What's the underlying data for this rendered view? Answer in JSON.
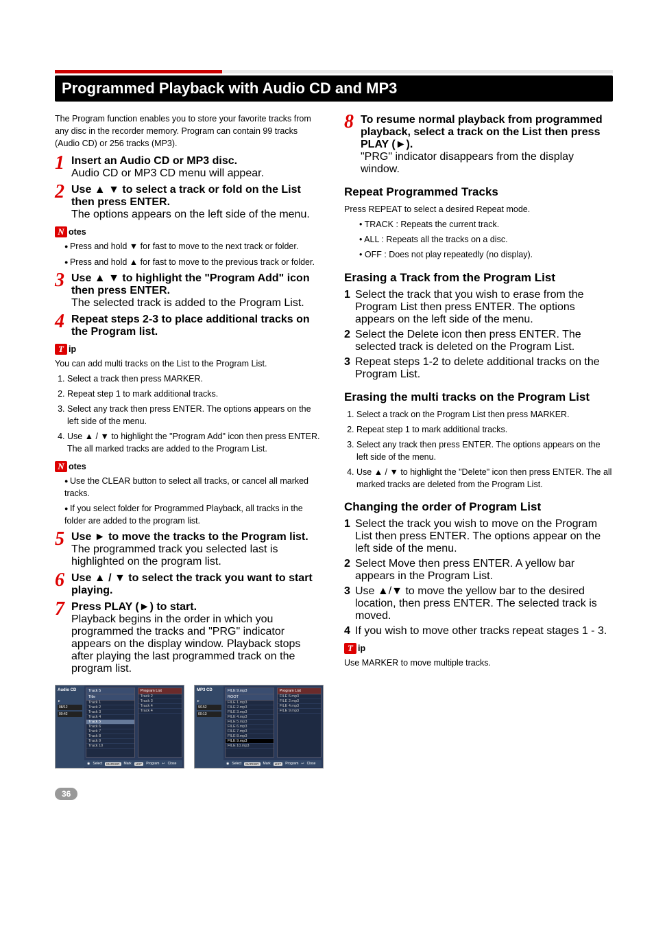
{
  "title": "Programmed Playback with Audio CD and MP3",
  "intro": "The Program function enables you to store your favorite tracks from any disc in the recorder memory. Program can contain 99 tracks (Audio CD) or 256 tracks (MP3).",
  "steps_left": [
    {
      "num": "1",
      "bold": "Insert an Audio CD or MP3 disc.",
      "sub": "Audio CD or MP3 CD menu will appear."
    },
    {
      "num": "2",
      "bold": "Use ▲ ▼ to select a track or fold on the List then press ENTER.",
      "sub": "The options appears on the left side of the menu."
    }
  ],
  "notes1_label": "otes",
  "notes1_items": [
    "Press and hold ▼ for fast to move to the next track or folder.",
    "Press and hold ▲ for fast to move to the previous track or folder."
  ],
  "steps_left2": [
    {
      "num": "3",
      "bold": "Use ▲ ▼ to highlight the \"Program Add\" icon then press ENTER.",
      "sub": "The selected track is added to the Program List."
    },
    {
      "num": "4",
      "bold": "Repeat steps 2-3 to place additional tracks on the Program list.",
      "sub": ""
    }
  ],
  "tip1_label": "ip",
  "tip1_lead": "You can add multi tracks on the List to the Program List.",
  "tip1_list": [
    "Select a track then press MARKER.",
    "Repeat step 1 to mark additional tracks.",
    "Select any track then press ENTER.\nThe options appears on the left side of the menu.",
    "Use ▲ / ▼ to highlight the \"Program Add\" icon then press ENTER.\nThe all marked tracks are added to the Program List."
  ],
  "notes2_label": "otes",
  "notes2_items": [
    "Use the CLEAR button to select all tracks, or cancel all marked tracks.",
    "If you select folder for Programmed Playback, all tracks in the folder are added to the program list."
  ],
  "steps_left3": [
    {
      "num": "5",
      "bold": "Use ► to move the tracks to the Program list.",
      "sub": "The programmed track you selected last is highlighted on the program list."
    },
    {
      "num": "6",
      "bold": "Use ▲ / ▼ to select the track you want to start playing.",
      "sub": ""
    },
    {
      "num": "7",
      "bold": "Press PLAY (►) to start.",
      "sub": "Playback begins in the order in which you programmed the tracks and \"PRG\" indicator appears on the display window.\nPlayback stops after playing the last programmed track on the program list."
    }
  ],
  "step8": {
    "num": "8",
    "bold": "To resume normal playback from programmed playback, select a track on the List then press PLAY (►).",
    "sub": "\"PRG\" indicator disappears from the display window."
  },
  "h_repeat": "Repeat Programmed Tracks",
  "repeat_lead": "Press REPEAT to select a desired Repeat mode.",
  "repeat_items": [
    "TRACK : Repeats the current track.",
    "ALL : Repeats all the tracks on a disc.",
    "OFF : Does not play repeatedly (no display)."
  ],
  "h_erase": "Erasing a Track from the Program List",
  "erase_steps": [
    "Select the track that you wish to erase from the Program List then press ENTER.\nThe options appears on the left side of the menu.",
    "Select the Delete icon then press ENTER.\nThe selected track is deleted on the Program List.",
    "Repeat steps 1-2 to delete additional tracks on the Program List."
  ],
  "h_erasemulti": "Erasing the multi tracks on the Program List",
  "erasemulti_steps": [
    "Select a track on the Program List then press MARKER.",
    "Repeat step 1 to mark additional tracks.",
    "Select any track then press ENTER.\nThe options appears on the left side of the menu.",
    "Use ▲ / ▼ to highlight the \"Delete\" icon then press ENTER.\nThe all marked tracks are deleted from the Program List."
  ],
  "h_change": "Changing the order of Program List",
  "change_steps": [
    "Select the track you wish to move on the Program List then press ENTER.\nThe options appear on the left side of the menu.",
    "Select Move then press ENTER.\nA yellow bar appears in the Program List.",
    "Use ▲/▼ to move the yellow bar to the desired location, then press ENTER.\nThe selected track is moved.",
    "If you wish to move other tracks repeat stages 1 - 3."
  ],
  "tip2_label": "ip",
  "tip2_text": "Use MARKER to move multiple tracks.",
  "scr_audio": {
    "side_title": "Audio CD",
    "track_label": "08/12",
    "time": "00:42",
    "header_top": "Track 5",
    "header_title": "Title",
    "prog_head": "Program List",
    "list": [
      "Track 1",
      "Track 2",
      "Track 3",
      "Track 4",
      "Track 5",
      "Track 6",
      "Track 7",
      "Track 8",
      "Track 9",
      "Track 10"
    ],
    "prog": [
      "Track 2",
      "Track 3",
      "Track 4",
      "Track 4"
    ],
    "bottom": [
      "Select",
      "MARKER",
      "Mark",
      "LIST",
      "Program",
      "Close"
    ]
  },
  "scr_mp3": {
    "side_title": "MP3 CD",
    "track_label": "9/152",
    "time": "00:13",
    "header_top": "FILE 9.mp3",
    "header_title": "ROOT",
    "prog_head": "Program List",
    "list": [
      "FILE 1.mp3",
      "FILE 2.mp3",
      "FILE 3.mp3",
      "FILE 4.mp3",
      "FILE 5.mp3",
      "FILE 6.mp3",
      "FILE 7.mp3",
      "FILE 8.mp3",
      "FILE 9.mp3",
      "FILE 10.mp3"
    ],
    "prog": [
      "FILE 6.mp3",
      "FILE 2.mp3",
      "FILE 4.mp3",
      "FILE 9.mp3"
    ],
    "bottom": [
      "Select",
      "MARKER",
      "Mark",
      "LIST",
      "Program",
      "Close"
    ]
  },
  "page_number": "36"
}
